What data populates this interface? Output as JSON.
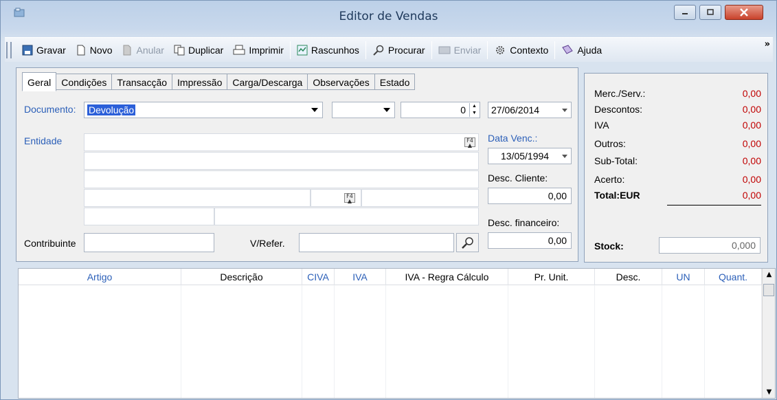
{
  "window": {
    "title": "Editor de Vendas"
  },
  "toolbar": {
    "gravar": "Gravar",
    "novo": "Novo",
    "anular": "Anular",
    "duplicar": "Duplicar",
    "imprimir": "Imprimir",
    "rascunhos": "Rascunhos",
    "procurar": "Procurar",
    "enviar": "Enviar",
    "contexto": "Contexto",
    "ajuda": "Ajuda",
    "more": "»"
  },
  "tabs": [
    "Geral",
    "Condições",
    "Transacção",
    "Impressão",
    "Carga/Descarga",
    "Observações",
    "Estado"
  ],
  "form": {
    "documento_label": "Documento:",
    "documento_value": "Devolução",
    "serie_value": "",
    "numero_value": "0",
    "data_value": "27/06/2014",
    "entidade_label": "Entidade",
    "data_venc_label": "Data Venc.:",
    "data_venc_value": "13/05/1994",
    "desc_cliente_label": "Desc. Cliente:",
    "desc_cliente_value": "0,00",
    "desc_financeiro_label": "Desc. financeiro:",
    "desc_financeiro_value": "0,00",
    "contribuinte_label": "Contribuinte",
    "contribuinte_value": "",
    "vrefer_label": "V/Refer.",
    "vrefer_value": ""
  },
  "summary": {
    "rows": [
      {
        "label": "Merc./Serv.:",
        "value": "0,00"
      },
      {
        "label": "Descontos:",
        "value": "0,00"
      },
      {
        "label": "IVA",
        "value": "0,00"
      },
      {
        "label": "Outros:",
        "value": "0,00"
      },
      {
        "label": "Sub-Total:",
        "value": "0,00"
      },
      {
        "label": "Acerto:",
        "value": "0,00"
      },
      {
        "label": "Total:EUR",
        "value": "0,00"
      }
    ],
    "stock_label": "Stock:",
    "stock_value": "0,000"
  },
  "grid": {
    "columns": [
      "Artigo",
      "Descrição",
      "CIVA",
      "IVA",
      "IVA - Regra Cálculo",
      "Pr. Unit.",
      "Desc.",
      "UN",
      "Quant."
    ],
    "blue_columns": [
      "Artigo",
      "CIVA",
      "IVA",
      "UN",
      "Quant."
    ],
    "rows": []
  },
  "colors": {
    "accent_blue": "#2b5fb8",
    "value_red": "#c00000",
    "selection": "#2b5fd9"
  }
}
